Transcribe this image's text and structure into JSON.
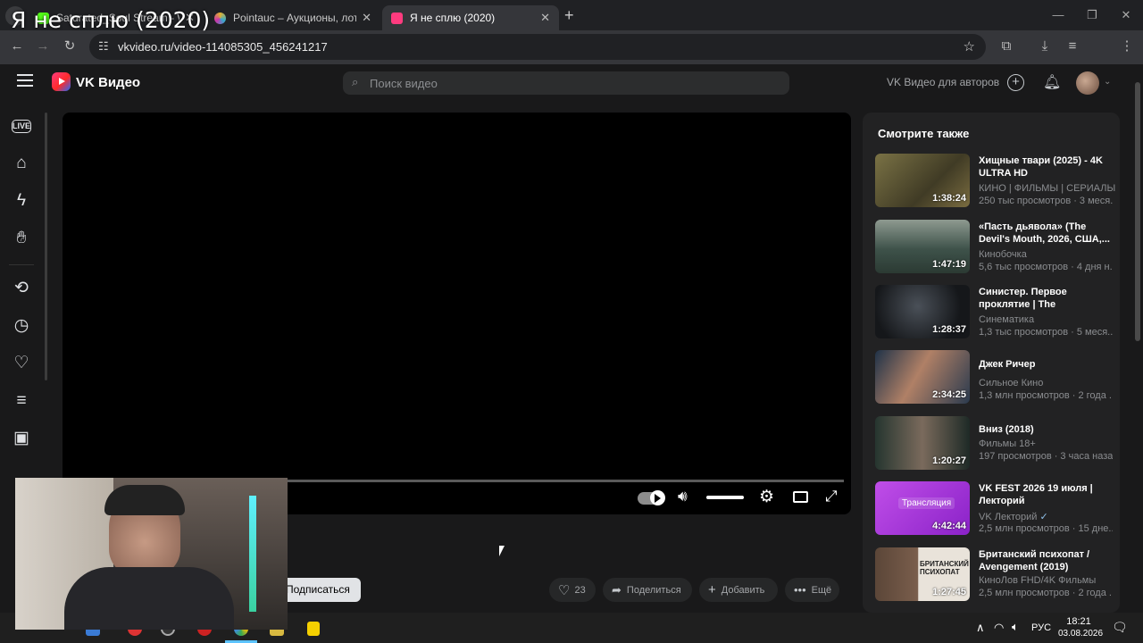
{
  "overlay_title": "Я не сплю (2020)",
  "browser": {
    "tabs": [
      {
        "title": "Saturated_Soul Stream - Wate",
        "color": "#53fc18"
      },
      {
        "title": "Pointauc – Аукционы, лотереи",
        "color": "#e0b030"
      },
      {
        "title": "Я не сплю (2020)",
        "color": "#ff3b7f"
      }
    ],
    "url": "vkvideo.ru/video-114085305_456241217"
  },
  "header": {
    "logo": "VK Видео",
    "search_placeholder": "Поиск видео",
    "authors_link": "VK Видео для авторов"
  },
  "nav": {
    "live_label": "LIVE"
  },
  "video": {
    "subscribe_label": "Подписаться",
    "likes": "23",
    "share_label": "Поделиться",
    "add_label": "Добавить",
    "more_label": "Ещё"
  },
  "recommendations": {
    "heading": "Смотрите также",
    "items": [
      {
        "title": "Хищные твари (2025) - 4K ULTRA HD",
        "channel": "КИНО | ФИЛЬМЫ | СЕРИАЛЫ",
        "meta": "250 тыс просмотров · 3 меся...",
        "duration": "1:38:24",
        "thumb": "#5b5a3c"
      },
      {
        "title": "«Пасть дьявола» (The Devil's Mouth, 2026, США,...",
        "channel": "Кинобочка",
        "meta": "5,6 тыс просмотров · 4 дня н...",
        "duration": "1:47:19",
        "thumb": "#55685e"
      },
      {
        "title": "Синистер. Первое проклятие | The Confessio...",
        "channel": "Синематика",
        "meta": "1,3 тыс просмотров · 5 меся...",
        "duration": "1:28:37",
        "thumb": "#2a2c30"
      },
      {
        "title": "Джек Ричер",
        "channel": "Сильное Кино",
        "meta": "1,3 млн просмотров · 2 года ...",
        "duration": "2:34:25",
        "thumb": "#3b4a5a"
      },
      {
        "title": "Вниз (2018)",
        "channel": "Фильмы 18+",
        "meta": "197 просмотров · 3 часа назад",
        "duration": "1:20:27",
        "thumb": "#2e3c36"
      },
      {
        "title": "VK FEST 2026 19 июля | Лекторий",
        "channel": "VK Лекторий",
        "meta": "2,5 млн просмотров · 15 дне...",
        "duration": "4:42:44",
        "thumb": "#a22fd6",
        "badge": "Трансляция"
      },
      {
        "title": "Британский психопат / Avengement (2019)",
        "channel": "КиноЛов FHD/4K Фильмы",
        "meta": "2,5 млн просмотров · 2 года ...",
        "duration": "1:27:45",
        "thumb": "#6b5446",
        "badge": "БРИТАНСКИЙ ПСИХОПАТ"
      }
    ]
  },
  "taskbar": {
    "lang": "РУС",
    "time": "18:21",
    "date": "03.08.2026"
  }
}
